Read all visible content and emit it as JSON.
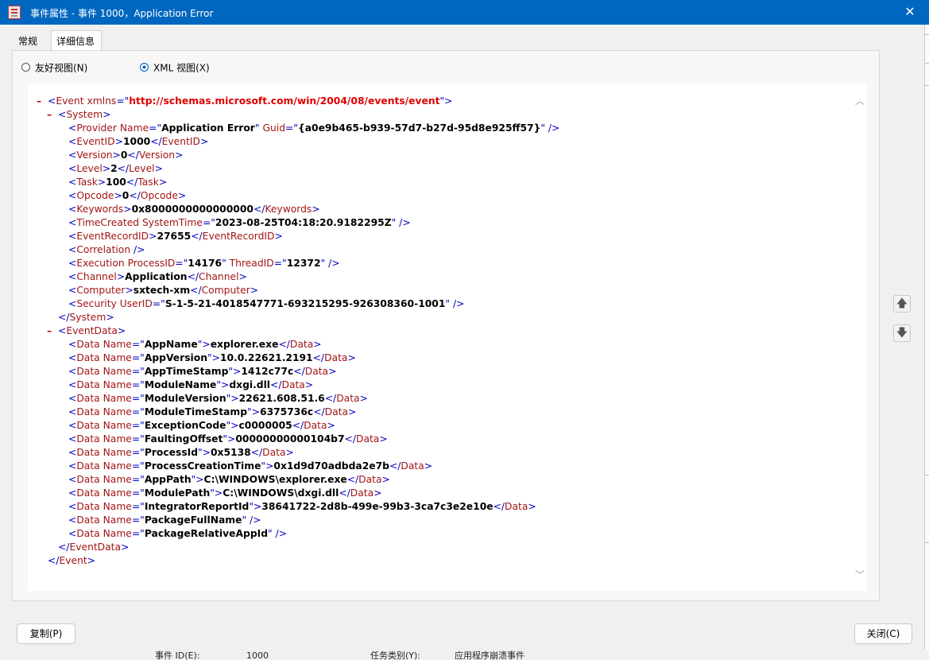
{
  "window": {
    "title": "事件属性 - 事件 1000，Application Error",
    "close_glyph": "✕"
  },
  "tabs": [
    {
      "label": "常规"
    },
    {
      "label": "详细信息"
    }
  ],
  "view_options": {
    "friendly": {
      "label": "友好视图(N)",
      "selected": false
    },
    "xml": {
      "label": "XML 视图(X)",
      "selected": true
    }
  },
  "xml": {
    "lines": [
      {
        "indent": 0,
        "toggle": "–",
        "parts": [
          [
            "tag",
            "<"
          ],
          [
            "name",
            "Event "
          ],
          [
            "attr",
            "xmlns"
          ],
          [
            "tag",
            "=\""
          ],
          [
            "ns",
            "http://schemas.microsoft.com/win/2004/08/events/event"
          ],
          [
            "tag",
            "\">"
          ]
        ]
      },
      {
        "indent": 1,
        "toggle": "–",
        "parts": [
          [
            "tag",
            "<"
          ],
          [
            "name",
            "System"
          ],
          [
            "tag",
            ">"
          ]
        ]
      },
      {
        "indent": 2,
        "parts": [
          [
            "tag",
            "<"
          ],
          [
            "name",
            "Provider "
          ],
          [
            "attr",
            "Name"
          ],
          [
            "tag",
            "=\""
          ],
          [
            "val",
            "Application Error"
          ],
          [
            "tag",
            "\" "
          ],
          [
            "attr",
            "Guid"
          ],
          [
            "tag",
            "=\""
          ],
          [
            "val",
            "{a0e9b465-b939-57d7-b27d-95d8e925ff57}"
          ],
          [
            "tag",
            "\" />"
          ]
        ]
      },
      {
        "indent": 2,
        "parts": [
          [
            "tag",
            "<"
          ],
          [
            "name",
            "EventID"
          ],
          [
            "tag",
            ">"
          ],
          [
            "val",
            "1000"
          ],
          [
            "tag",
            "</"
          ],
          [
            "name",
            "EventID"
          ],
          [
            "tag",
            ">"
          ]
        ]
      },
      {
        "indent": 2,
        "parts": [
          [
            "tag",
            "<"
          ],
          [
            "name",
            "Version"
          ],
          [
            "tag",
            ">"
          ],
          [
            "val",
            "0"
          ],
          [
            "tag",
            "</"
          ],
          [
            "name",
            "Version"
          ],
          [
            "tag",
            ">"
          ]
        ]
      },
      {
        "indent": 2,
        "parts": [
          [
            "tag",
            "<"
          ],
          [
            "name",
            "Level"
          ],
          [
            "tag",
            ">"
          ],
          [
            "val",
            "2"
          ],
          [
            "tag",
            "</"
          ],
          [
            "name",
            "Level"
          ],
          [
            "tag",
            ">"
          ]
        ]
      },
      {
        "indent": 2,
        "parts": [
          [
            "tag",
            "<"
          ],
          [
            "name",
            "Task"
          ],
          [
            "tag",
            ">"
          ],
          [
            "val",
            "100"
          ],
          [
            "tag",
            "</"
          ],
          [
            "name",
            "Task"
          ],
          [
            "tag",
            ">"
          ]
        ]
      },
      {
        "indent": 2,
        "parts": [
          [
            "tag",
            "<"
          ],
          [
            "name",
            "Opcode"
          ],
          [
            "tag",
            ">"
          ],
          [
            "val",
            "0"
          ],
          [
            "tag",
            "</"
          ],
          [
            "name",
            "Opcode"
          ],
          [
            "tag",
            ">"
          ]
        ]
      },
      {
        "indent": 2,
        "parts": [
          [
            "tag",
            "<"
          ],
          [
            "name",
            "Keywords"
          ],
          [
            "tag",
            ">"
          ],
          [
            "val",
            "0x8000000000000000"
          ],
          [
            "tag",
            "</"
          ],
          [
            "name",
            "Keywords"
          ],
          [
            "tag",
            ">"
          ]
        ]
      },
      {
        "indent": 2,
        "parts": [
          [
            "tag",
            "<"
          ],
          [
            "name",
            "TimeCreated "
          ],
          [
            "attr",
            "SystemTime"
          ],
          [
            "tag",
            "=\""
          ],
          [
            "val",
            "2023-08-25T04:18:20.9182295Z"
          ],
          [
            "tag",
            "\" />"
          ]
        ]
      },
      {
        "indent": 2,
        "parts": [
          [
            "tag",
            "<"
          ],
          [
            "name",
            "EventRecordID"
          ],
          [
            "tag",
            ">"
          ],
          [
            "val",
            "27655"
          ],
          [
            "tag",
            "</"
          ],
          [
            "name",
            "EventRecordID"
          ],
          [
            "tag",
            ">"
          ]
        ]
      },
      {
        "indent": 2,
        "parts": [
          [
            "tag",
            "<"
          ],
          [
            "name",
            "Correlation "
          ],
          [
            "tag",
            "/>"
          ]
        ]
      },
      {
        "indent": 2,
        "parts": [
          [
            "tag",
            "<"
          ],
          [
            "name",
            "Execution "
          ],
          [
            "attr",
            "ProcessID"
          ],
          [
            "tag",
            "=\""
          ],
          [
            "val",
            "14176"
          ],
          [
            "tag",
            "\" "
          ],
          [
            "attr",
            "ThreadID"
          ],
          [
            "tag",
            "=\""
          ],
          [
            "val",
            "12372"
          ],
          [
            "tag",
            "\" />"
          ]
        ]
      },
      {
        "indent": 2,
        "parts": [
          [
            "tag",
            "<"
          ],
          [
            "name",
            "Channel"
          ],
          [
            "tag",
            ">"
          ],
          [
            "val",
            "Application"
          ],
          [
            "tag",
            "</"
          ],
          [
            "name",
            "Channel"
          ],
          [
            "tag",
            ">"
          ]
        ]
      },
      {
        "indent": 2,
        "parts": [
          [
            "tag",
            "<"
          ],
          [
            "name",
            "Computer"
          ],
          [
            "tag",
            ">"
          ],
          [
            "val",
            "sxtech-xm"
          ],
          [
            "tag",
            "</"
          ],
          [
            "name",
            "Computer"
          ],
          [
            "tag",
            ">"
          ]
        ]
      },
      {
        "indent": 2,
        "parts": [
          [
            "tag",
            "<"
          ],
          [
            "name",
            "Security "
          ],
          [
            "attr",
            "UserID"
          ],
          [
            "tag",
            "=\""
          ],
          [
            "val",
            "S-1-5-21-4018547771-693215295-926308360-1001"
          ],
          [
            "tag",
            "\" />"
          ]
        ]
      },
      {
        "indent": 1,
        "parts": [
          [
            "tag",
            "</"
          ],
          [
            "name",
            "System"
          ],
          [
            "tag",
            ">"
          ]
        ]
      },
      {
        "indent": 1,
        "toggle": "–",
        "parts": [
          [
            "tag",
            "<"
          ],
          [
            "name",
            "EventData"
          ],
          [
            "tag",
            ">"
          ]
        ]
      },
      {
        "indent": 2,
        "parts": [
          [
            "tag",
            "<"
          ],
          [
            "name",
            "Data "
          ],
          [
            "attr",
            "Name"
          ],
          [
            "tag",
            "=\""
          ],
          [
            "val",
            "AppName"
          ],
          [
            "tag",
            "\">"
          ],
          [
            "val",
            "explorer.exe"
          ],
          [
            "tag",
            "</"
          ],
          [
            "name",
            "Data"
          ],
          [
            "tag",
            ">"
          ]
        ]
      },
      {
        "indent": 2,
        "parts": [
          [
            "tag",
            "<"
          ],
          [
            "name",
            "Data "
          ],
          [
            "attr",
            "Name"
          ],
          [
            "tag",
            "=\""
          ],
          [
            "val",
            "AppVersion"
          ],
          [
            "tag",
            "\">"
          ],
          [
            "val",
            "10.0.22621.2191"
          ],
          [
            "tag",
            "</"
          ],
          [
            "name",
            "Data"
          ],
          [
            "tag",
            ">"
          ]
        ]
      },
      {
        "indent": 2,
        "parts": [
          [
            "tag",
            "<"
          ],
          [
            "name",
            "Data "
          ],
          [
            "attr",
            "Name"
          ],
          [
            "tag",
            "=\""
          ],
          [
            "val",
            "AppTimeStamp"
          ],
          [
            "tag",
            "\">"
          ],
          [
            "val",
            "1412c77c"
          ],
          [
            "tag",
            "</"
          ],
          [
            "name",
            "Data"
          ],
          [
            "tag",
            ">"
          ]
        ]
      },
      {
        "indent": 2,
        "parts": [
          [
            "tag",
            "<"
          ],
          [
            "name",
            "Data "
          ],
          [
            "attr",
            "Name"
          ],
          [
            "tag",
            "=\""
          ],
          [
            "val",
            "ModuleName"
          ],
          [
            "tag",
            "\">"
          ],
          [
            "val",
            "dxgi.dll"
          ],
          [
            "tag",
            "</"
          ],
          [
            "name",
            "Data"
          ],
          [
            "tag",
            ">"
          ]
        ]
      },
      {
        "indent": 2,
        "parts": [
          [
            "tag",
            "<"
          ],
          [
            "name",
            "Data "
          ],
          [
            "attr",
            "Name"
          ],
          [
            "tag",
            "=\""
          ],
          [
            "val",
            "ModuleVersion"
          ],
          [
            "tag",
            "\">"
          ],
          [
            "val",
            "22621.608.51.6"
          ],
          [
            "tag",
            "</"
          ],
          [
            "name",
            "Data"
          ],
          [
            "tag",
            ">"
          ]
        ]
      },
      {
        "indent": 2,
        "parts": [
          [
            "tag",
            "<"
          ],
          [
            "name",
            "Data "
          ],
          [
            "attr",
            "Name"
          ],
          [
            "tag",
            "=\""
          ],
          [
            "val",
            "ModuleTimeStamp"
          ],
          [
            "tag",
            "\">"
          ],
          [
            "val",
            "6375736c"
          ],
          [
            "tag",
            "</"
          ],
          [
            "name",
            "Data"
          ],
          [
            "tag",
            ">"
          ]
        ]
      },
      {
        "indent": 2,
        "parts": [
          [
            "tag",
            "<"
          ],
          [
            "name",
            "Data "
          ],
          [
            "attr",
            "Name"
          ],
          [
            "tag",
            "=\""
          ],
          [
            "val",
            "ExceptionCode"
          ],
          [
            "tag",
            "\">"
          ],
          [
            "val",
            "c0000005"
          ],
          [
            "tag",
            "</"
          ],
          [
            "name",
            "Data"
          ],
          [
            "tag",
            ">"
          ]
        ]
      },
      {
        "indent": 2,
        "parts": [
          [
            "tag",
            "<"
          ],
          [
            "name",
            "Data "
          ],
          [
            "attr",
            "Name"
          ],
          [
            "tag",
            "=\""
          ],
          [
            "val",
            "FaultingOffset"
          ],
          [
            "tag",
            "\">"
          ],
          [
            "val",
            "00000000000104b7"
          ],
          [
            "tag",
            "</"
          ],
          [
            "name",
            "Data"
          ],
          [
            "tag",
            ">"
          ]
        ]
      },
      {
        "indent": 2,
        "parts": [
          [
            "tag",
            "<"
          ],
          [
            "name",
            "Data "
          ],
          [
            "attr",
            "Name"
          ],
          [
            "tag",
            "=\""
          ],
          [
            "val",
            "ProcessId"
          ],
          [
            "tag",
            "\">"
          ],
          [
            "val",
            "0x5138"
          ],
          [
            "tag",
            "</"
          ],
          [
            "name",
            "Data"
          ],
          [
            "tag",
            ">"
          ]
        ]
      },
      {
        "indent": 2,
        "parts": [
          [
            "tag",
            "<"
          ],
          [
            "name",
            "Data "
          ],
          [
            "attr",
            "Name"
          ],
          [
            "tag",
            "=\""
          ],
          [
            "val",
            "ProcessCreationTime"
          ],
          [
            "tag",
            "\">"
          ],
          [
            "val",
            "0x1d9d70adbda2e7b"
          ],
          [
            "tag",
            "</"
          ],
          [
            "name",
            "Data"
          ],
          [
            "tag",
            ">"
          ]
        ]
      },
      {
        "indent": 2,
        "parts": [
          [
            "tag",
            "<"
          ],
          [
            "name",
            "Data "
          ],
          [
            "attr",
            "Name"
          ],
          [
            "tag",
            "=\""
          ],
          [
            "val",
            "AppPath"
          ],
          [
            "tag",
            "\">"
          ],
          [
            "val",
            "C:\\WINDOWS\\explorer.exe"
          ],
          [
            "tag",
            "</"
          ],
          [
            "name",
            "Data"
          ],
          [
            "tag",
            ">"
          ]
        ]
      },
      {
        "indent": 2,
        "parts": [
          [
            "tag",
            "<"
          ],
          [
            "name",
            "Data "
          ],
          [
            "attr",
            "Name"
          ],
          [
            "tag",
            "=\""
          ],
          [
            "val",
            "ModulePath"
          ],
          [
            "tag",
            "\">"
          ],
          [
            "val",
            "C:\\WINDOWS\\dxgi.dll"
          ],
          [
            "tag",
            "</"
          ],
          [
            "name",
            "Data"
          ],
          [
            "tag",
            ">"
          ]
        ]
      },
      {
        "indent": 2,
        "parts": [
          [
            "tag",
            "<"
          ],
          [
            "name",
            "Data "
          ],
          [
            "attr",
            "Name"
          ],
          [
            "tag",
            "=\""
          ],
          [
            "val",
            "IntegratorReportId"
          ],
          [
            "tag",
            "\">"
          ],
          [
            "val",
            "38641722-2d8b-499e-99b3-3ca7c3e2e10e"
          ],
          [
            "tag",
            "</"
          ],
          [
            "name",
            "Data"
          ],
          [
            "tag",
            ">"
          ]
        ]
      },
      {
        "indent": 2,
        "parts": [
          [
            "tag",
            "<"
          ],
          [
            "name",
            "Data "
          ],
          [
            "attr",
            "Name"
          ],
          [
            "tag",
            "=\""
          ],
          [
            "val",
            "PackageFullName"
          ],
          [
            "tag",
            "\" />"
          ]
        ]
      },
      {
        "indent": 2,
        "parts": [
          [
            "tag",
            "<"
          ],
          [
            "name",
            "Data "
          ],
          [
            "attr",
            "Name"
          ],
          [
            "tag",
            "=\""
          ],
          [
            "val",
            "PackageRelativeAppId"
          ],
          [
            "tag",
            "\" />"
          ]
        ]
      },
      {
        "indent": 1,
        "parts": [
          [
            "tag",
            "</"
          ],
          [
            "name",
            "EventData"
          ],
          [
            "tag",
            ">"
          ]
        ]
      },
      {
        "indent": 0,
        "parts": [
          [
            "tag",
            "</"
          ],
          [
            "name",
            "Event"
          ],
          [
            "tag",
            ">"
          ]
        ]
      }
    ]
  },
  "scroll": {
    "up_glyph": "︿",
    "down_glyph": "﹀"
  },
  "nav": {
    "up_glyph": "🡅",
    "down_glyph": "🡇"
  },
  "buttons": {
    "copy": "复制(P)",
    "close": "关闭(C)"
  },
  "background_window": {
    "event_id_label": "事件 ID(E):",
    "event_id_value": "1000",
    "task_category_label": "任务类别(Y):",
    "task_category_value": "应用程序崩溃事件"
  }
}
